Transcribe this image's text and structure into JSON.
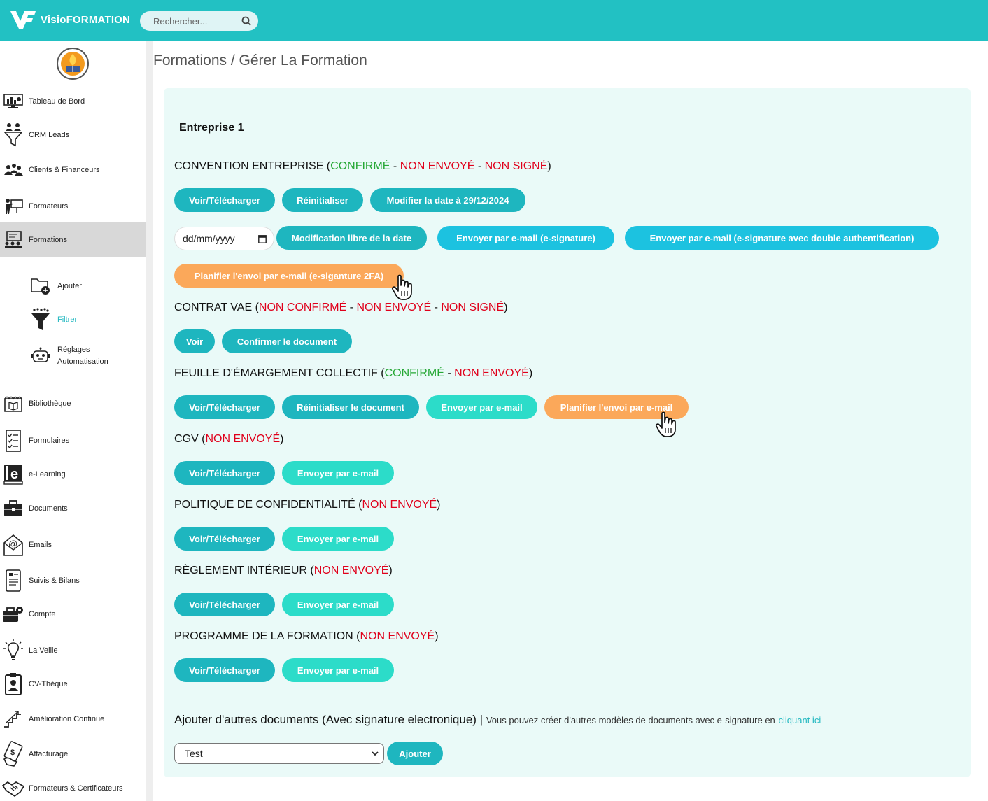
{
  "header": {
    "brand": "VisioFORMATION",
    "search_placeholder": "Rechercher..."
  },
  "sidebar": {
    "items": [
      {
        "label": "Tableau de Bord",
        "icon": "dashboard-monitor-icon"
      },
      {
        "label": "CRM Leads",
        "icon": "funnel-people-icon"
      },
      {
        "label": "Clients & Financeurs",
        "icon": "people-group-icon"
      },
      {
        "label": "Formateurs",
        "icon": "trainer-board-icon"
      },
      {
        "label": "Formations",
        "icon": "training-board-icon"
      },
      {
        "label": "Bibliothèque",
        "icon": "library-icon"
      },
      {
        "label": "Formulaires",
        "icon": "checklist-icon"
      },
      {
        "label": "e-Learning",
        "icon": "elearning-book-icon"
      },
      {
        "label": "Documents",
        "icon": "briefcase-icon"
      },
      {
        "label": "Emails",
        "icon": "email-at-icon"
      },
      {
        "label": "Suivis & Bilans",
        "icon": "report-tablet-icon"
      },
      {
        "label": "Compte",
        "icon": "account-gear-icon"
      },
      {
        "label": "La Veille",
        "icon": "lightbulb-icon"
      },
      {
        "label": "CV-Thèque",
        "icon": "id-badge-icon"
      },
      {
        "label": "Amélioration Continue",
        "icon": "stairs-up-icon"
      },
      {
        "label": "Affacturage",
        "icon": "hand-money-icon"
      },
      {
        "label": "Formateurs & Certificateurs",
        "icon": "handshake-icon"
      }
    ],
    "subitems": [
      {
        "label": "Ajouter",
        "icon": "folder-add-icon"
      },
      {
        "label": "Filtrer",
        "icon": "filter-funnel-icon"
      },
      {
        "label": "Réglages",
        "label2": "Automatisation",
        "icon": "robot-icon"
      }
    ]
  },
  "breadcrumb": "Formations / Gérer La Formation",
  "company": "Entreprise 1",
  "sections": {
    "convention": {
      "title": "CONVENTION ENTREPRISE",
      "s1": "CONFIRMÉ",
      "s2": "NON ENVOYÉ",
      "s3": "NON SIGNÉ",
      "btn_view": "Voir/Télécharger",
      "btn_reset": "Réinitialiser",
      "btn_modify_date": "Modifier la date à 29/12/2024",
      "date_placeholder": "dd/mm/yyyy",
      "btn_free_date": "Modification libre de la date",
      "btn_send_esign": "Envoyer par e-mail (e-signature)",
      "btn_send_2fa": "Envoyer par e-mail (e-signature avec double authentification)",
      "btn_schedule_2fa": "Planifier l'envoi par e-mail (e-siganture 2FA)"
    },
    "vae": {
      "title": "CONTRAT VAE",
      "s1": "NON CONFIRMÉ",
      "s2": "NON ENVOYÉ",
      "s3": "NON SIGNÉ",
      "btn_view": "Voir",
      "btn_confirm": "Confirmer le document"
    },
    "emargement": {
      "title": "FEUILLE D'ÉMARGEMENT COLLECTIF",
      "s1": "CONFIRMÉ",
      "s2": "NON ENVOYÉ",
      "btn_view": "Voir/Télécharger",
      "btn_reset": "Réinitialiser le document",
      "btn_send": "Envoyer par e-mail",
      "btn_schedule": "Planifier l'envoi par e-mail"
    },
    "cgv": {
      "title": "CGV",
      "s1": "NON ENVOYÉ",
      "btn_view": "Voir/Télécharger",
      "btn_send": "Envoyer par e-mail"
    },
    "politique": {
      "title": "POLITIQUE DE CONFIDENTIALITÉ",
      "s1": "NON ENVOYÉ",
      "btn_view": "Voir/Télécharger",
      "btn_send": "Envoyer par e-mail"
    },
    "reglement": {
      "title": "RÈGLEMENT INTÉRIEUR",
      "s1": "NON ENVOYÉ",
      "btn_view": "Voir/Télécharger",
      "btn_send": "Envoyer par e-mail"
    },
    "programme": {
      "title": "PROGRAMME DE LA FORMATION",
      "s1": "NON ENVOYÉ",
      "btn_view": "Voir/Télécharger",
      "btn_send": "Envoyer par e-mail"
    }
  },
  "add_docs": {
    "title": "Ajouter d'autres documents (Avec signature electronique) |",
    "hint": "Vous pouvez créer d'autres modèles de documents avec e-signature en",
    "link": "cliquant ici",
    "select_value": "Test",
    "btn_add": "Ajouter"
  },
  "colors": {
    "header": "#22c1c3",
    "btn_dark": "#1eb6bf",
    "btn_light": "#2cdcc9",
    "btn_blue": "#1cc2e0",
    "btn_orange": "#fba85a",
    "status_ok": "#27a836",
    "status_ko": "#e0001b"
  }
}
